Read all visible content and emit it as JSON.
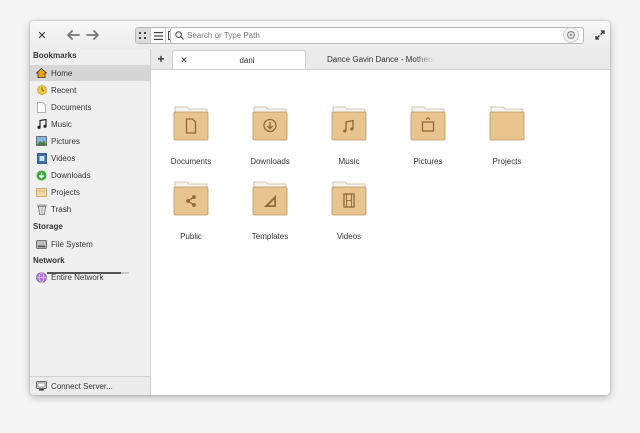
{
  "window": {
    "search": {
      "placeholder": "Search or Type Path"
    }
  },
  "sidebar": {
    "sections": {
      "bookmarks": "Bookmarks",
      "storage": "Storage",
      "network": "Network"
    },
    "bookmarks": [
      {
        "label": "Home",
        "icon": "home-icon",
        "selected": true
      },
      {
        "label": "Recent",
        "icon": "recent-icon"
      },
      {
        "label": "Documents",
        "icon": "document-icon"
      },
      {
        "label": "Music",
        "icon": "music-note-icon"
      },
      {
        "label": "Pictures",
        "icon": "pictures-icon"
      },
      {
        "label": "Videos",
        "icon": "video-icon"
      },
      {
        "label": "Downloads",
        "icon": "download-icon"
      },
      {
        "label": "Projects",
        "icon": "projects-folder-icon"
      },
      {
        "label": "Trash",
        "icon": "trash-icon"
      }
    ],
    "storage": [
      {
        "label": "File System",
        "icon": "drive-icon",
        "usage_fraction": 0.9
      }
    ],
    "network": [
      {
        "label": "Entire Network",
        "icon": "network-icon"
      }
    ],
    "connect_server": "Connect Server..."
  },
  "tabs": [
    {
      "label": "dani",
      "active": true
    },
    {
      "label": "Dance Gavin Dance - Mothership",
      "active": false
    }
  ],
  "files": [
    {
      "name": "Documents",
      "emblem": "document-icon"
    },
    {
      "name": "Downloads",
      "emblem": "download-icon"
    },
    {
      "name": "Music",
      "emblem": "music-note-icon"
    },
    {
      "name": "Pictures",
      "emblem": "pictures-icon"
    },
    {
      "name": "Projects",
      "emblem": "none"
    },
    {
      "name": "Public",
      "emblem": "share-icon"
    },
    {
      "name": "Templates",
      "emblem": "template-icon"
    },
    {
      "name": "Videos",
      "emblem": "film-icon"
    }
  ],
  "colors": {
    "folder_fill": "#e8c58f",
    "folder_tab": "#f7f4ef",
    "folder_stroke": "#b99560",
    "emblem": "#8a6a3a",
    "selection": "#d6d6d6"
  }
}
